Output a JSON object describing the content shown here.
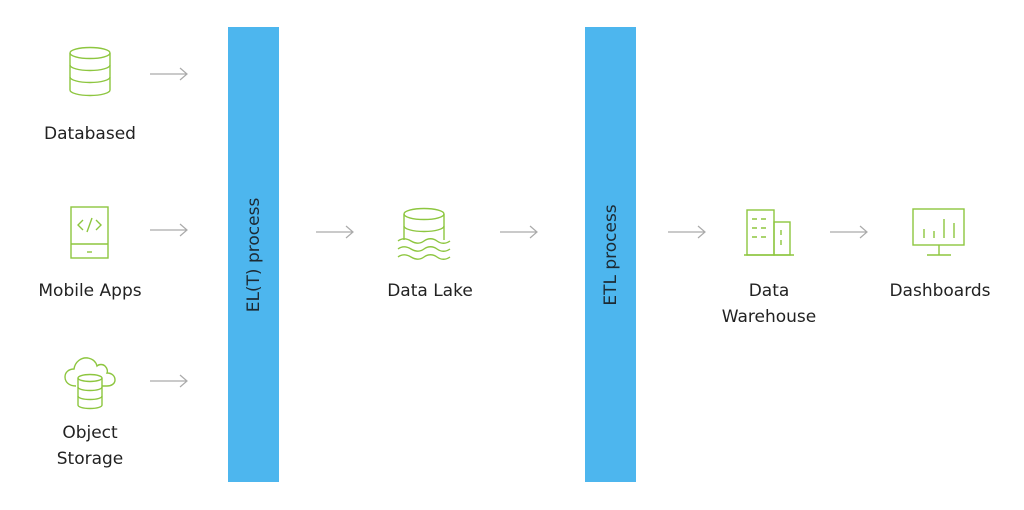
{
  "colors": {
    "process_bar": "#4db6ee",
    "icon": "#8dc63f",
    "arrow": "#aaaaaa",
    "text": "#222222"
  },
  "sources": [
    {
      "label": "Databased",
      "icon": "database-icon"
    },
    {
      "label": "Mobile Apps",
      "icon": "mobile-code-icon"
    },
    {
      "label_line1": "Object",
      "label_line2": "Storage",
      "icon": "cloud-database-icon"
    }
  ],
  "processes": [
    {
      "label": "EL(T) process"
    },
    {
      "label": "ETL process"
    }
  ],
  "data_lake": {
    "label": "Data Lake",
    "icon": "data-lake-icon"
  },
  "data_warehouse": {
    "label_line1": "Data",
    "label_line2": "Warehouse",
    "icon": "building-icon"
  },
  "dashboards": {
    "label": "Dashboards",
    "icon": "monitor-chart-icon"
  }
}
